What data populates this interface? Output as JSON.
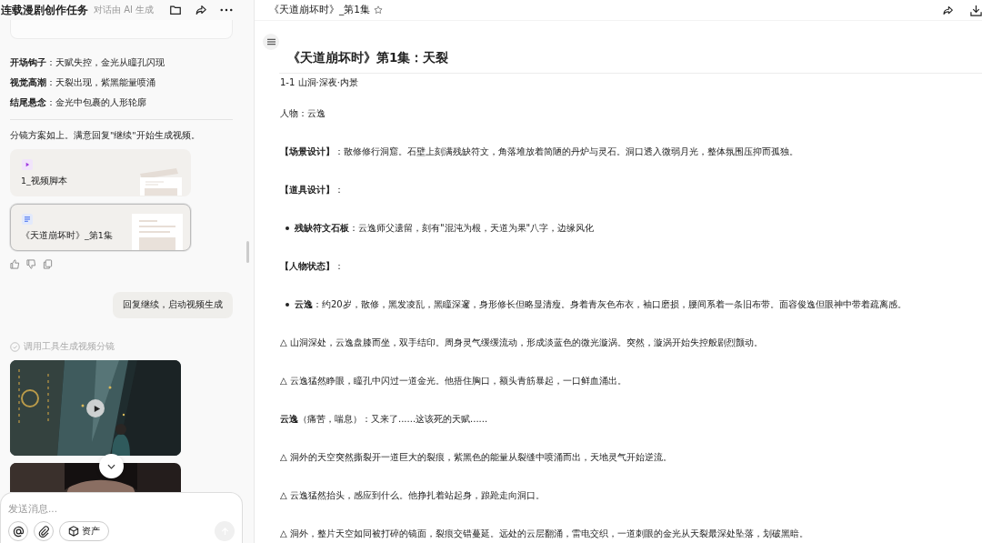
{
  "chat": {
    "title": "连载漫剧创作任务",
    "subtitle": "对话由 AI 生成",
    "hooks": [
      {
        "text": "**开场钩子**：天赋失控，金光从瞳孔闪现"
      },
      {
        "text": "**视觉高潮**：天裂出现，紫黑能量喷涌"
      },
      {
        "text": "**结尾悬念**：金光中包裹的人形轮廓"
      }
    ],
    "message": "分镜方案如上。满意回复\"继续\"开始生成视频。",
    "files": [
      {
        "kind": "video",
        "name": "1_视频脚本",
        "selected": false
      },
      {
        "kind": "doc",
        "name": "《天道崩坏时》_第1集",
        "selected": true
      }
    ],
    "user_message": "回复继续，启动视频生成",
    "tool_status": "调用工具生成视频分镜",
    "videos": [
      {
        "kind": "picture",
        "playable": true
      },
      {
        "kind": "picture",
        "playable": false
      }
    ],
    "input": {
      "placeholder": "发送消息...",
      "asset_button": "资产"
    }
  },
  "document": {
    "tab_title": "《天道崩坏时》_第1集",
    "title": "《天道崩坏时》第1集：天裂",
    "blocks": [
      {
        "kind": "scene",
        "text": "1-1 山洞·深夜·内景"
      },
      {
        "kind": "para",
        "text": "人物：云逸"
      },
      {
        "kind": "para",
        "text": "**【场景设计】**：散修修行洞窟。石壁上刻满残缺符文，角落堆放着简陋的丹炉与灵石。洞口透入微弱月光，整体氛围压抑而孤独。"
      },
      {
        "kind": "para",
        "text": "**【道具设计】**："
      },
      {
        "kind": "bullet",
        "text": "**残缺符文石板**：云逸师父遗留，刻有\"混沌为根，天道为果\"八字，边缘风化"
      },
      {
        "kind": "para",
        "text": "**【人物状态】**："
      },
      {
        "kind": "bullet",
        "text": "**云逸**：约20岁，散修，黑发凌乱，黑瞳深邃，身形修长但略显清瘦。身着青灰色布衣，袖口磨损，腰间系着一条旧布带。面容俊逸但眼神中带着疏离感。"
      },
      {
        "kind": "para",
        "text": "△ 山洞深处，云逸盘膝而坐，双手结印。周身灵气缓缓流动，形成淡蓝色的微光漩涡。突然，漩涡开始失控般剧烈颤动。"
      },
      {
        "kind": "para",
        "text": "△ 云逸猛然睁眼，瞳孔中闪过一道金光。他捂住胸口，额头青筋暴起，一口鲜血涌出。"
      },
      {
        "kind": "para",
        "text": "**云逸**（痛苦，喘息）：又来了......这该死的天赋......"
      },
      {
        "kind": "para",
        "text": "△ 洞外的天空突然撕裂开一道巨大的裂痕，紫黑色的能量从裂缝中喷涌而出，天地灵气开始逆流。"
      },
      {
        "kind": "para",
        "text": "△ 云逸猛然抬头，感应到什么。他挣扎着站起身，踉跄走向洞口。"
      },
      {
        "kind": "para",
        "text": "△ 洞外，整片天空如同被打碎的镜面，裂痕交错蔓延。远处的云层翻涌，雷电交织，一道刺眼的金光从天裂最深处坠落，划破黑暗。"
      }
    ]
  }
}
